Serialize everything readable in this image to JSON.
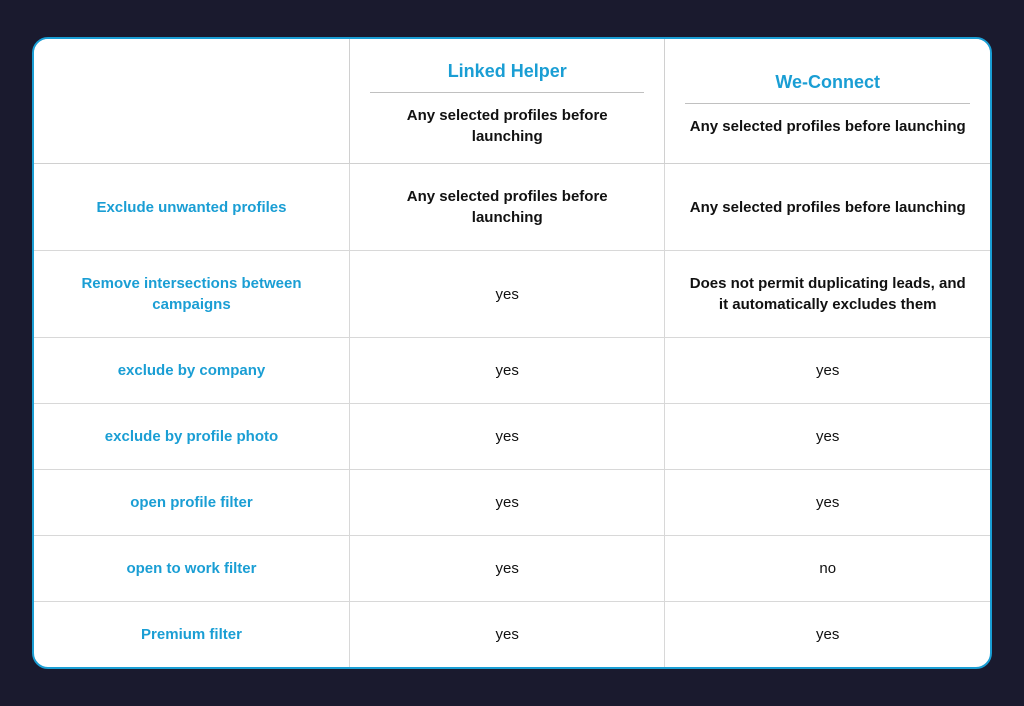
{
  "table": {
    "columns": {
      "lh": {
        "title": "Linked Helper",
        "subtitle": "Any selected profiles before launching"
      },
      "wc": {
        "title": "We-Connect",
        "subtitle": "Any selected profiles before launching"
      }
    },
    "rows": [
      {
        "feature": "Exclude unwanted profiles",
        "lh": "Any selected profiles before launching",
        "wc": "Any selected profiles before launching",
        "lh_bold": true,
        "wc_bold": true
      },
      {
        "feature": "Remove intersections between campaigns",
        "lh": "yes",
        "wc": "Does not permit duplicating leads, and it automatically excludes them",
        "lh_bold": false,
        "wc_bold": true
      },
      {
        "feature": "exclude by company",
        "lh": "yes",
        "wc": "yes",
        "lh_bold": false,
        "wc_bold": false
      },
      {
        "feature": "exclude by profile photo",
        "lh": "yes",
        "wc": "yes",
        "lh_bold": false,
        "wc_bold": false
      },
      {
        "feature": "open profile filter",
        "lh": "yes",
        "wc": "yes",
        "lh_bold": false,
        "wc_bold": false
      },
      {
        "feature": "open to work filter",
        "lh": "yes",
        "wc": "no",
        "lh_bold": false,
        "wc_bold": false
      },
      {
        "feature": "Premium filter",
        "lh": "yes",
        "wc": "yes",
        "lh_bold": false,
        "wc_bold": false
      }
    ]
  }
}
